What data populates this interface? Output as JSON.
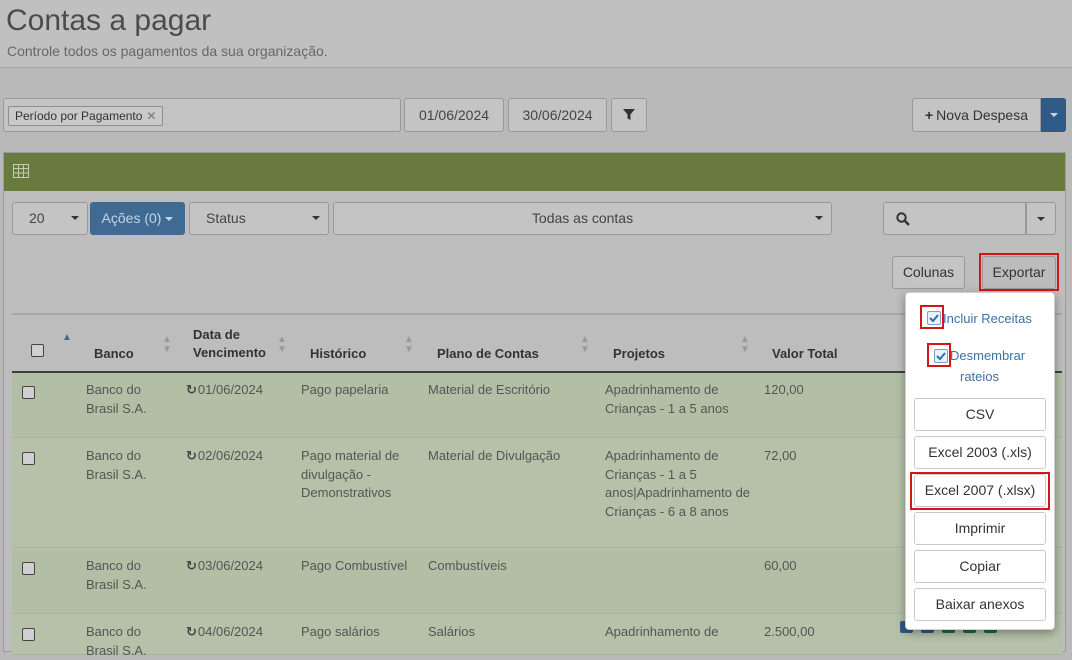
{
  "header": {
    "title": "Contas a pagar",
    "subtitle": "Controle todos os pagamentos da sua organização."
  },
  "filters": {
    "tag": "Período por Pagamento",
    "tag_close": "✕",
    "date_start": "01/06/2024",
    "date_end": "30/06/2024"
  },
  "toolbar": {
    "new_label": "Nova Despesa",
    "new_icon": "+"
  },
  "controls": {
    "page_size": "20",
    "actions": "Ações (0)",
    "status": "Status",
    "accounts": "Todas as contas",
    "columns_label": "Colunas",
    "export_label": "Exportar"
  },
  "table": {
    "headers": {
      "bank": "Banco",
      "due_line1": "Data de",
      "due_line2": "Vencimento",
      "history": "Histórico",
      "plan": "Plano de Contas",
      "projects": "Projetos",
      "total": "Valor Total"
    },
    "rows": [
      {
        "bank": "Banco do Brasil S.A.",
        "due": "01/06/2024",
        "history": "Pago papelaria",
        "plan": "Material de Escritório",
        "projects": "Apadrinhamento de Crianças - 1 a 5 anos",
        "total": "120,00"
      },
      {
        "bank": "Banco do Brasil S.A.",
        "due": "02/06/2024",
        "history": "Pago material de divulgação - Demonstrativos",
        "plan": "Material de Divulgação",
        "projects": "Apadrinhamento de Crianças - 1 a 5 anos|Apadrinhamento de Crianças - 6 a 8 anos",
        "total": "72,00"
      },
      {
        "bank": "Banco do Brasil S.A.",
        "due": "03/06/2024",
        "history": "Pago Combustível",
        "plan": "Combustíveis",
        "projects": "",
        "total": "60,00"
      },
      {
        "bank": "Banco do Brasil S.A.",
        "due": "04/06/2024",
        "history": "Pago salários",
        "plan": "Salários",
        "projects": "Apadrinhamento de",
        "total": "2.500,00"
      }
    ]
  },
  "export_menu": {
    "include_income": "Incluir Receitas",
    "split_line1": "Desmembrar",
    "split_line2": "rateios",
    "csv": "CSV",
    "xls": "Excel 2003 (.xls)",
    "xlsx": "Excel 2007 (.xlsx)",
    "print": "Imprimir",
    "copy": "Copiar",
    "download": "Baixar anexos"
  },
  "colors": {
    "panel_header": "#687a3e",
    "primary": "#3e6a93",
    "highlight": "#d01818",
    "link": "#3d72a8"
  }
}
